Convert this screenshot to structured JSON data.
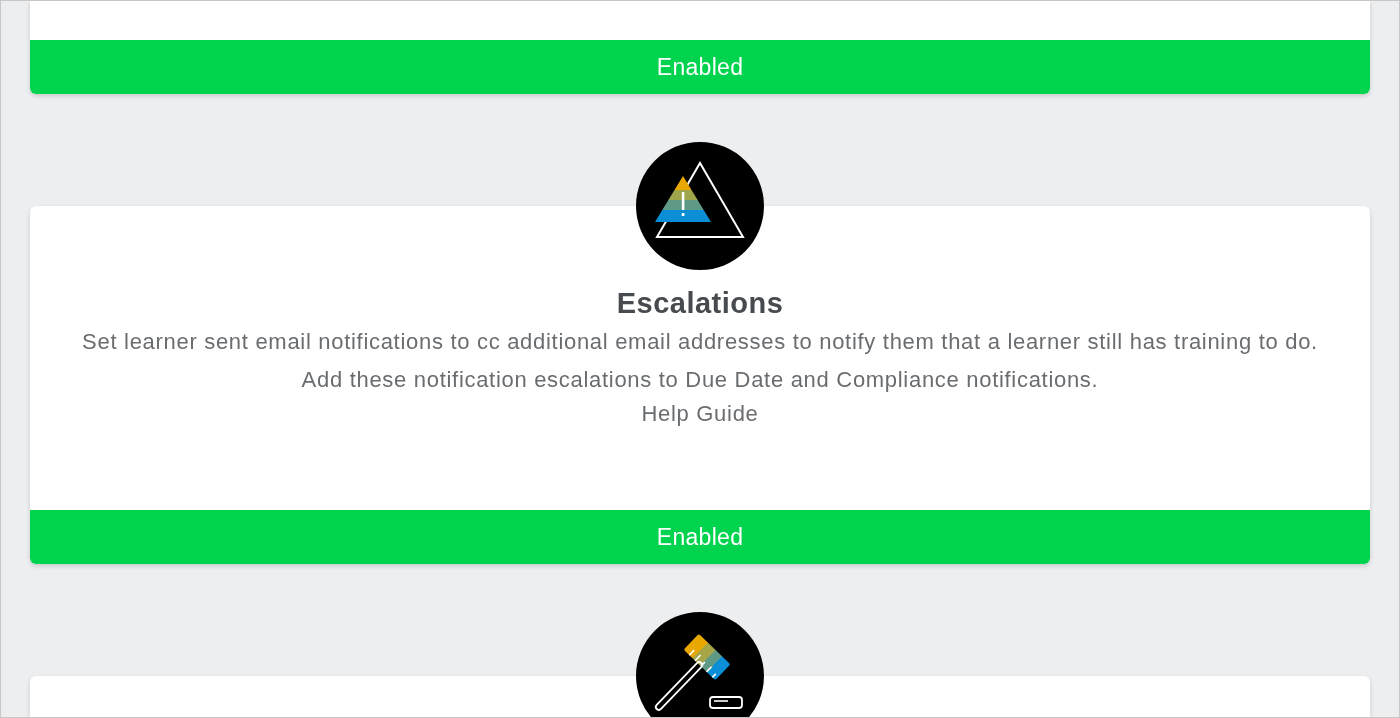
{
  "cards": [
    {
      "kind": "plain",
      "status": {
        "label": "Enabled",
        "enabled": true
      }
    },
    {
      "kind": "alert",
      "title": "Escalations",
      "description": [
        "Set learner sent email notifications to cc additional email addresses to notify them that a learner still has training to do.",
        "Add these notification escalations to Due Date and Compliance notifications."
      ],
      "link": "Help Guide",
      "status": {
        "label": "Enabled",
        "enabled": true
      }
    },
    {
      "kind": "gavel"
    }
  ]
}
